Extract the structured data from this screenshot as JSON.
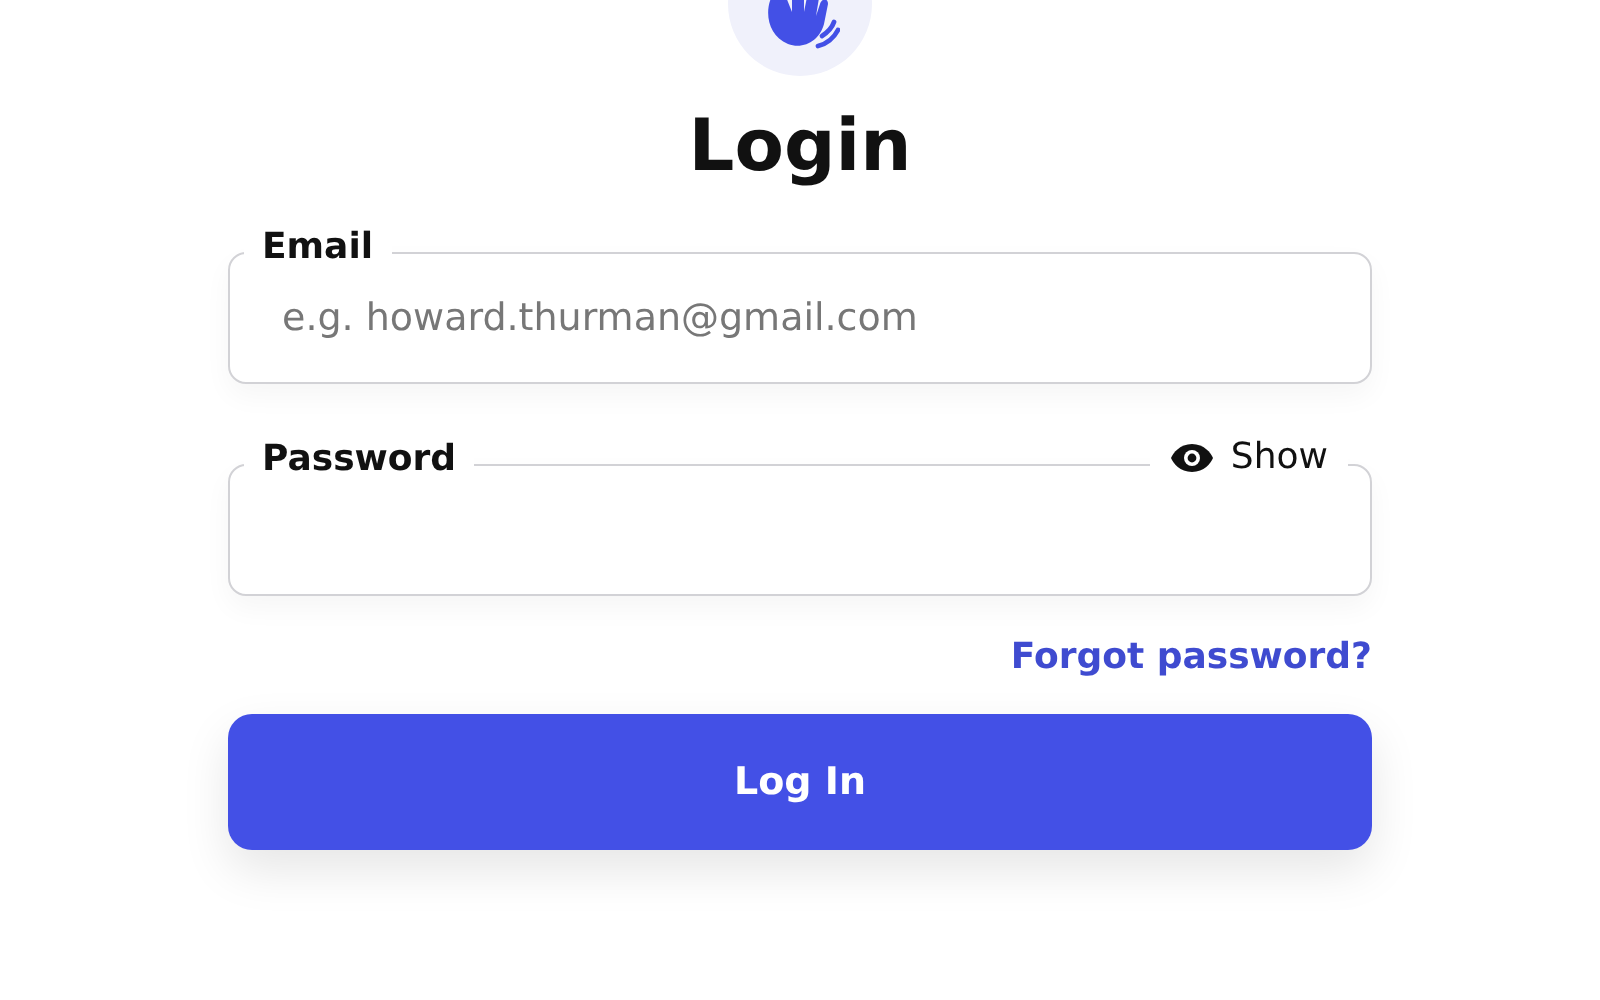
{
  "title": "Login",
  "fields": [
    {
      "kind": "email",
      "label": "Email",
      "placeholder": "e.g. howard.thurman@gmail.com"
    },
    {
      "kind": "password",
      "label": "Password",
      "toggle": "Show"
    }
  ],
  "forgot_link": "Forgot password?",
  "submit": "Log In"
}
